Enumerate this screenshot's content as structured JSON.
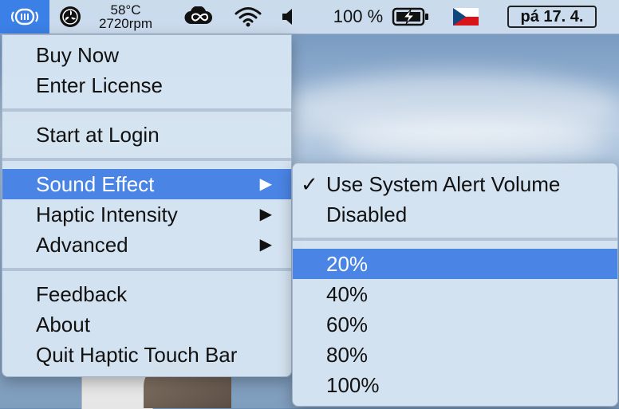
{
  "menubar": {
    "app_icon": "haptic-touch-bar-icon",
    "sensor": {
      "temperature": "58°C",
      "fan_speed": "2720rpm"
    },
    "battery_percent": "100 %",
    "date": "pá 17. 4."
  },
  "main_menu": {
    "items": [
      {
        "label": "Buy Now"
      },
      {
        "label": "Enter License"
      },
      {
        "label": "Start at Login"
      },
      {
        "label": "Sound Effect",
        "submenu": true,
        "highlighted": true
      },
      {
        "label": "Haptic Intensity",
        "submenu": true
      },
      {
        "label": "Advanced",
        "submenu": true
      },
      {
        "label": "Feedback"
      },
      {
        "label": "About"
      },
      {
        "label": "Quit Haptic Touch Bar"
      }
    ],
    "submenu_arrow": "▶"
  },
  "sound_submenu": {
    "check_glyph": "✓",
    "items": [
      {
        "label": "Use System Alert Volume",
        "checked": true
      },
      {
        "label": "Disabled"
      },
      {
        "label": "20%",
        "highlighted": true
      },
      {
        "label": "40%"
      },
      {
        "label": "60%"
      },
      {
        "label": "80%"
      },
      {
        "label": "100%"
      }
    ]
  },
  "colors": {
    "highlight": "#4a84e4",
    "menu_bg": "#d6e4f2",
    "app_icon_bg": "#3b80e6"
  }
}
